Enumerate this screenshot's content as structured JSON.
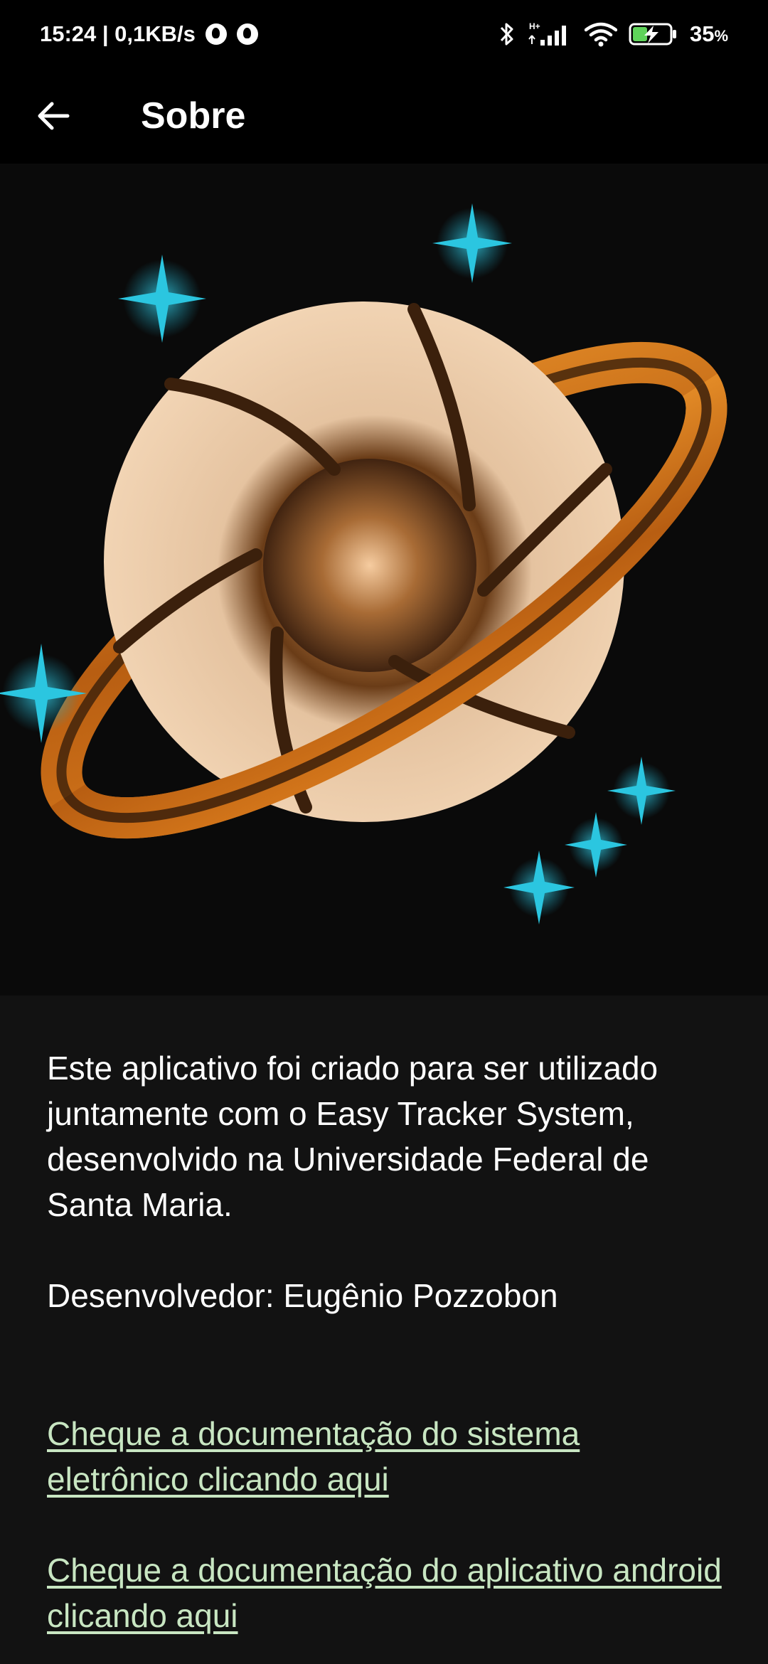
{
  "status_bar": {
    "time_speed": "15:24 | 0,1KB/s",
    "network_type": "H+",
    "battery_percent": "35",
    "battery_unit": "%",
    "icons": [
      "notification-icon",
      "notification-icon",
      "bluetooth-icon",
      "signal-icon",
      "wifi-icon",
      "battery-charging-icon"
    ]
  },
  "app_bar": {
    "back_icon": "arrow-left-icon",
    "title": "Sobre"
  },
  "hero": {
    "image": "saturn-aperture-logo",
    "colors": {
      "planet": "#e8c39c",
      "ring": "#c86e1a",
      "star": "#2bc6e0"
    }
  },
  "content": {
    "description": "Este aplicativo foi criado para ser utilizado juntamente com o Easy Tracker System, desenvolvido na Universidade Federal de Santa Maria.",
    "developer": "Desenvolvedor: Eugênio Pozzobon",
    "links": [
      {
        "label": "Cheque a documentação do sistema eletrônico clicando aqui"
      },
      {
        "label": "Cheque a documentação do aplicativo android clicando aqui"
      }
    ],
    "link_color": "#c8e6c2"
  }
}
